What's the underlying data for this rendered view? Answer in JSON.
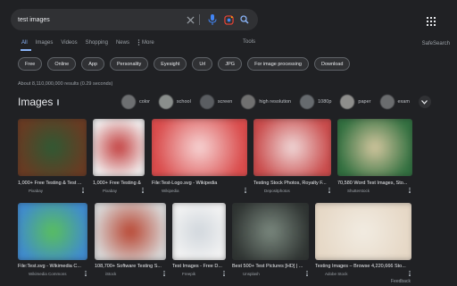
{
  "search": {
    "query": "test images"
  },
  "tabs": [
    "All",
    "Images",
    "Videos",
    "Shopping",
    "News"
  ],
  "more_label": "More",
  "tools_label": "Tools",
  "safesearch_label": "SafeSearch",
  "chips": [
    "Free",
    "Online",
    "App",
    "Personality",
    "Eyesight",
    "Url",
    "JPG",
    "For image processing",
    "Download"
  ],
  "result_stats": "About 8,110,000,000 results (0.29 seconds)",
  "images_heading": "Images",
  "filters": [
    {
      "label": "color",
      "thumb_color": "#6d6f71"
    },
    {
      "label": "school",
      "thumb_color": "#8a8e8c"
    },
    {
      "label": "screen",
      "thumb_color": "#5a5d61"
    },
    {
      "label": "high resolution",
      "thumb_color": "#707070"
    },
    {
      "label": "1080p",
      "thumb_color": "#666a6e"
    },
    {
      "label": "paper",
      "thumb_color": "#8e8e8c"
    },
    {
      "label": "exam",
      "thumb_color": "#6a6c6e"
    }
  ],
  "results_row1": [
    {
      "title": "1,000+ Free Testing & Test ...",
      "source": "Pixabay",
      "colors": [
        "#6a3a22",
        "#2e5a34"
      ]
    },
    {
      "title": "1,000+ Free Testing & Test ...",
      "source": "Pixabay",
      "colors": [
        "#f2f2f2",
        "#c23a3a"
      ]
    },
    {
      "title": "File:Test-Logo.svg - Wikipedia",
      "source": "Wikipedia",
      "colors": [
        "#d94a4a",
        "#f7d6d6"
      ]
    },
    {
      "title": "Testing Stock Photos, Royalty F...",
      "source": "Depositphotos",
      "colors": [
        "#c84848",
        "#f0dada"
      ]
    },
    {
      "title": "70,580 Word Test Images, Sto...",
      "source": "Shutterstock",
      "colors": [
        "#2f6e3e",
        "#d6c8a0"
      ]
    }
  ],
  "results_row2": [
    {
      "title": "File:Test.svg - Wikimedia C...",
      "source": "Wikimedia Commons",
      "colors": [
        "#3f8ad0",
        "#5ac05a"
      ]
    },
    {
      "title": "108,700+ Software Testing S...",
      "source": "iStock",
      "colors": [
        "#d8d8d8",
        "#b8432f"
      ]
    },
    {
      "title": "Test Images - Free D...",
      "source": "Freepik",
      "colors": [
        "#f4f4f4",
        "#d0d6dc"
      ]
    },
    {
      "title": "Best 500+ Test Pictures [HD] | ...",
      "source": "Unsplash",
      "colors": [
        "#2f3432",
        "#7c8a80"
      ]
    },
    {
      "title": "Testing Images – Browse 4,220,666 Sto...",
      "source": "Adobe Stock",
      "colors": [
        "#e6d8c6",
        "#f2ece2"
      ]
    }
  ],
  "feedback_label": "Feedback"
}
